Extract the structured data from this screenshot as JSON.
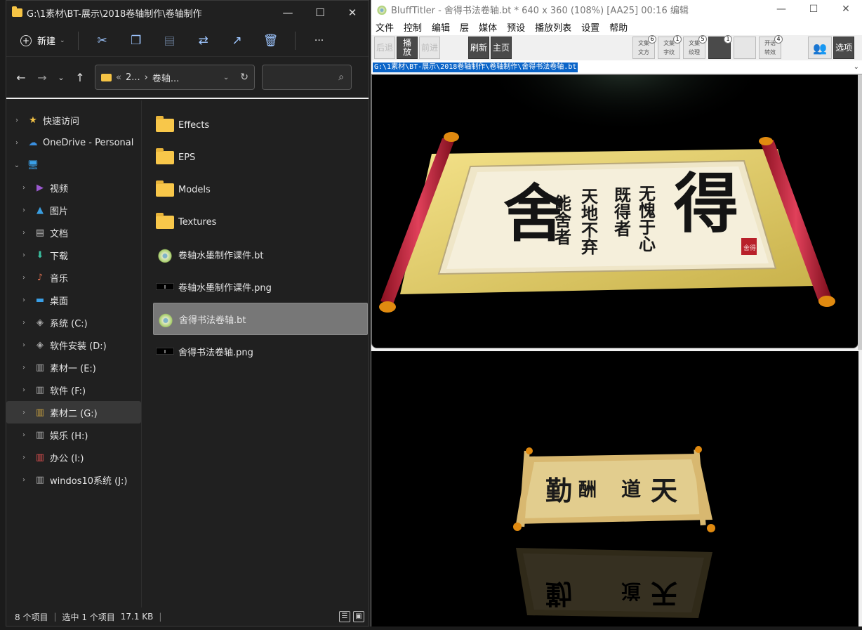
{
  "explorer": {
    "title": "G:\\1素材\\BT-展示\\2018卷轴制作\\卷轴制作",
    "window_buttons": {
      "minimize": "—",
      "maximize": "☐",
      "close": "✕"
    },
    "toolbar": {
      "new_label": "新建",
      "more": "···"
    },
    "address": {
      "crumb1": "2...",
      "crumb2": "卷轴...",
      "prefix": "«",
      "sep": "›"
    },
    "nav": [
      {
        "label": "快速访问",
        "icon": "star-icon",
        "glyph": "★",
        "color": "#f6c445",
        "indent": 0
      },
      {
        "label": "OneDrive - Personal",
        "icon": "cloud-icon",
        "glyph": "☁",
        "color": "#3a8fe0",
        "indent": 0
      },
      {
        "label": "",
        "icon": "computer-icon",
        "glyph": "🖥",
        "color": "#3aa0e8",
        "indent": 0,
        "expanded": true
      },
      {
        "label": "视频",
        "icon": "video-icon",
        "glyph": "▶",
        "color": "#9b59d0",
        "indent": 1
      },
      {
        "label": "图片",
        "icon": "picture-icon",
        "glyph": "▲",
        "color": "#3a9ee0",
        "indent": 1
      },
      {
        "label": "文档",
        "icon": "document-icon",
        "glyph": "▤",
        "color": "#bbbbbb",
        "indent": 1
      },
      {
        "label": "下载",
        "icon": "download-icon",
        "glyph": "⬇",
        "color": "#3ac0a0",
        "indent": 1
      },
      {
        "label": "音乐",
        "icon": "music-icon",
        "glyph": "♪",
        "color": "#e07050",
        "indent": 1
      },
      {
        "label": "桌面",
        "icon": "desktop-icon",
        "glyph": "▬",
        "color": "#3aa0e8",
        "indent": 1
      },
      {
        "label": "系统 (C:)",
        "icon": "drive-icon",
        "glyph": "◈",
        "color": "#aaaaaa",
        "indent": 1
      },
      {
        "label": "软件安装 (D:)",
        "icon": "drive-icon",
        "glyph": "◈",
        "color": "#aaaaaa",
        "indent": 1
      },
      {
        "label": "素材一 (E:)",
        "icon": "drive-icon",
        "glyph": "▥",
        "color": "#aaaaaa",
        "indent": 1
      },
      {
        "label": "软件 (F:)",
        "icon": "drive-icon",
        "glyph": "▥",
        "color": "#aaaaaa",
        "indent": 1
      },
      {
        "label": "素材二 (G:)",
        "icon": "drive-icon",
        "glyph": "▥",
        "color": "#c8a040",
        "indent": 1,
        "selected": true
      },
      {
        "label": "娱乐 (H:)",
        "icon": "drive-icon",
        "glyph": "▥",
        "color": "#aaaaaa",
        "indent": 1
      },
      {
        "label": "办公 (I:)",
        "icon": "drive-icon",
        "glyph": "▥",
        "color": "#e05050",
        "indent": 1
      },
      {
        "label": "windos10系统 (J:)",
        "icon": "drive-icon",
        "glyph": "▥",
        "color": "#aaaaaa",
        "indent": 1
      }
    ],
    "files": [
      {
        "name": "Effects",
        "type": "folder"
      },
      {
        "name": "EPS",
        "type": "folder"
      },
      {
        "name": "Models",
        "type": "folder"
      },
      {
        "name": "Textures",
        "type": "folder"
      },
      {
        "name": "卷轴水墨制作课件.bt",
        "type": "bt"
      },
      {
        "name": "卷轴水墨制作课件.png",
        "type": "png"
      },
      {
        "name": "舍得书法卷轴.bt",
        "type": "bt",
        "selected": true
      },
      {
        "name": "舍得书法卷轴.png",
        "type": "png"
      }
    ],
    "status": {
      "count": "8 个项目",
      "selection": "选中 1 个项目",
      "size": "17.1 KB"
    }
  },
  "blufftitler": {
    "title": "BluffTitler - 舍得书法卷轴.bt * 640 x 360 (108%) [AA25] 00:16 编辑",
    "window_buttons": {
      "minimize": "—",
      "maximize": "☐",
      "close": "✕"
    },
    "menu": [
      "文件",
      "控制",
      "编辑",
      "层",
      "媒体",
      "预设",
      "播放列表",
      "设置",
      "帮助"
    ],
    "tools": {
      "back": "后退",
      "play": "播\n放",
      "forward": "前进",
      "refresh": "刷新",
      "home": "主页",
      "options": "选项",
      "layer_buttons": [
        {
          "label": "文集\n文方",
          "badge": "6"
        },
        {
          "label": "文集\n字纹",
          "badge": "1"
        },
        {
          "label": "文集\n纹理",
          "badge": "5"
        },
        {
          "label": "",
          "badge": "1"
        },
        {
          "label": "",
          "badge": ""
        },
        {
          "label": "开话\n转效",
          "badge": "4"
        }
      ]
    },
    "path": "G:\\1素材\\BT-展示\\2018卷轴制作\\卷轴制作\\舍得书法卷轴.bt",
    "scroll1": {
      "big_left": "舍",
      "big_right": "得",
      "columns": [
        "能舍者",
        "天地不弃",
        "既得者",
        "无愧于心"
      ],
      "seal": "舍得"
    },
    "scroll2": {
      "text": [
        "勤",
        "酬",
        "道",
        "天"
      ]
    }
  }
}
